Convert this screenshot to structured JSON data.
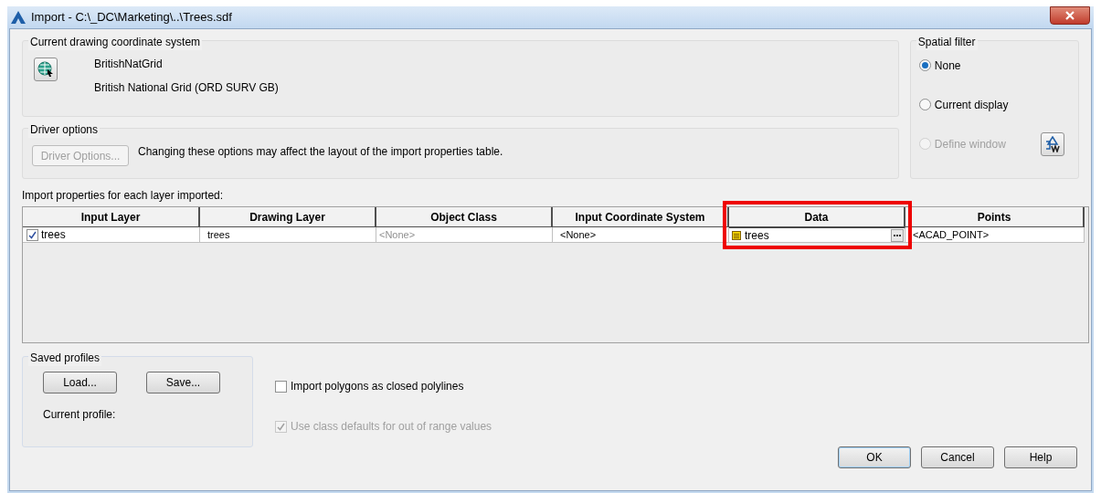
{
  "window": {
    "title": "Import - C:\\_DC\\Marketing\\..\\Trees.sdf"
  },
  "coordinate_system": {
    "title": "Current drawing coordinate system",
    "code": "BritishNatGrid",
    "name": "British National Grid (ORD SURV GB)"
  },
  "driver_options": {
    "title": "Driver options",
    "button": {
      "label": "Driver Options...",
      "disabled": true
    },
    "note": "Changing these options may affect the layout of the import properties table."
  },
  "spatial_filter": {
    "title": "Spatial filter",
    "options": [
      {
        "label": "None",
        "selected": true,
        "disabled": false
      },
      {
        "label": "Current display",
        "selected": false,
        "disabled": false
      },
      {
        "label": "Define window",
        "selected": false,
        "disabled": true
      }
    ]
  },
  "table": {
    "label": "Import properties for each layer imported:",
    "columns": [
      {
        "label": "Input Layer",
        "highlighted": false
      },
      {
        "label": "Drawing Layer",
        "highlighted": false
      },
      {
        "label": "Object Class",
        "highlighted": false
      },
      {
        "label": "Input Coordinate System",
        "highlighted": false
      },
      {
        "label": "Data",
        "highlighted": true
      },
      {
        "label": "Points",
        "highlighted": false
      }
    ],
    "rows": [
      {
        "cells": [
          {
            "kind": "checkbox",
            "text": "trees",
            "checked": true
          },
          {
            "kind": "text",
            "text": "trees"
          },
          {
            "kind": "placeholder",
            "text": "<None>"
          },
          {
            "kind": "text",
            "text": "<None>"
          },
          {
            "kind": "picker",
            "text": "trees"
          },
          {
            "kind": "text",
            "text": "<ACAD_POINT>"
          }
        ]
      }
    ]
  },
  "saved_profiles": {
    "title": "Saved profiles",
    "buttons": [
      "Load...",
      "Save..."
    ],
    "current_profile_label": "Current profile:"
  },
  "options": [
    {
      "label": "Import polygons as closed polylines",
      "checked": false,
      "disabled": false
    },
    {
      "label": "Use class defaults for out of range values",
      "checked": true,
      "disabled": true
    }
  ],
  "buttons": [
    {
      "label": "OK",
      "default": true
    },
    {
      "label": "Cancel",
      "default": false
    },
    {
      "label": "Help",
      "default": false
    }
  ]
}
